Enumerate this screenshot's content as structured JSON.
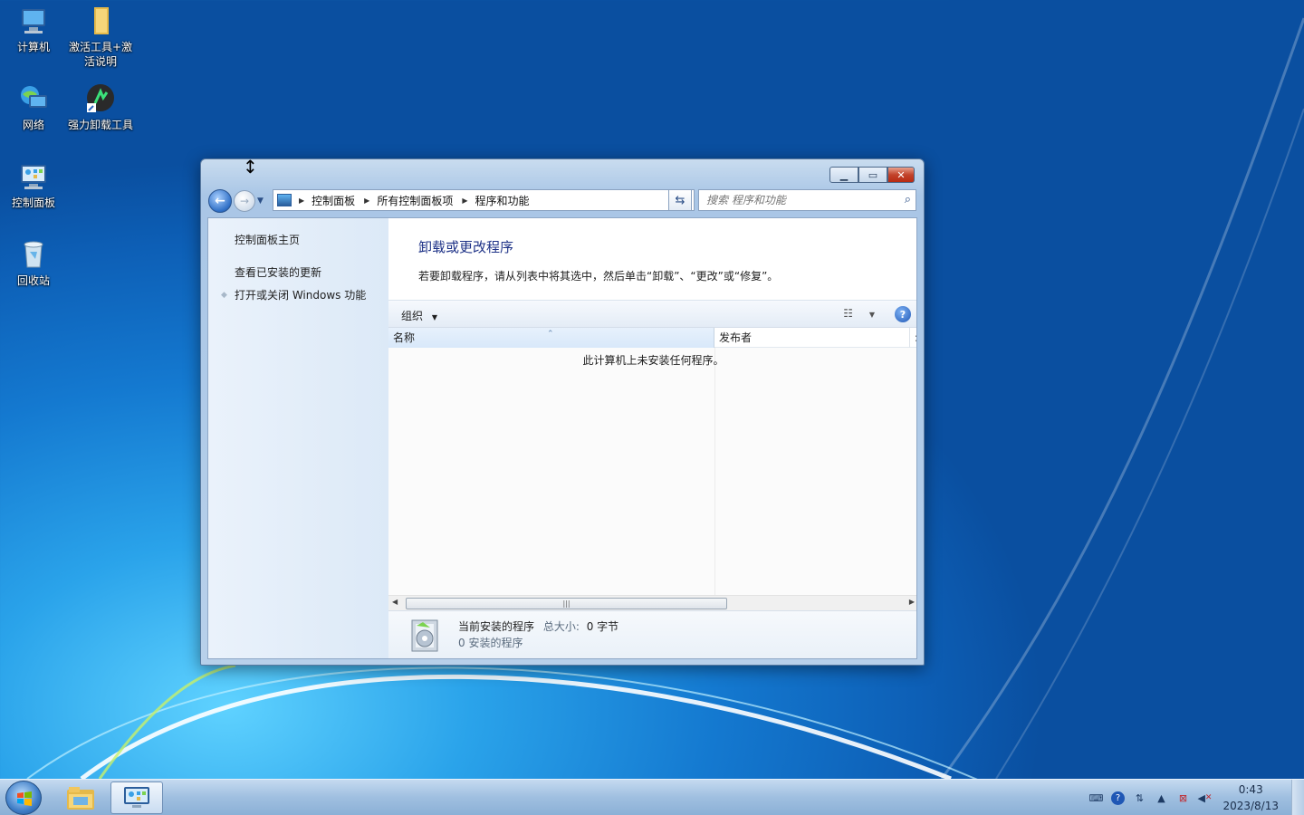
{
  "desktop": {
    "icons": [
      {
        "label": "计算机",
        "icon": "computer-icon"
      },
      {
        "label": "激活工具+激活说明",
        "icon": "folder-icon"
      },
      {
        "label": "网络",
        "icon": "network-icon"
      },
      {
        "label": "强力卸载工具",
        "icon": "uninstaller-icon"
      },
      {
        "label": "控制面板",
        "icon": "control-panel-icon"
      },
      {
        "label": "回收站",
        "icon": "recycle-bin-icon"
      }
    ]
  },
  "window": {
    "breadcrumb": [
      "控制面板",
      "所有控制面板项",
      "程序和功能"
    ],
    "search_placeholder": "搜索 程序和功能",
    "left_pane": {
      "home_link": "控制面板主页",
      "links": [
        "查看已安装的更新",
        "打开或关闭 Windows 功能"
      ]
    },
    "main": {
      "title": "卸载或更改程序",
      "description": "若要卸载程序，请从列表中将其选中，然后单击“卸载”、“更改”或“修复”。"
    },
    "toolbar": {
      "organize": "组织"
    },
    "columns": [
      "名称",
      "发布者"
    ],
    "empty_message": "此计算机上未安装任何程序。",
    "details": {
      "title": "当前安装的程序",
      "size_label": "总大小:",
      "size_value": "0 字节",
      "count_text": "0 安装的程序"
    }
  },
  "taskbar": {
    "apps": [
      "explorer-icon",
      "control-panel-icon"
    ],
    "clock_time": "0:43",
    "clock_date": "2023/8/13"
  },
  "colors": {
    "title_blue": "#1e3287",
    "desktop_blue": "#1479d0",
    "close_red": "#c2432b"
  }
}
